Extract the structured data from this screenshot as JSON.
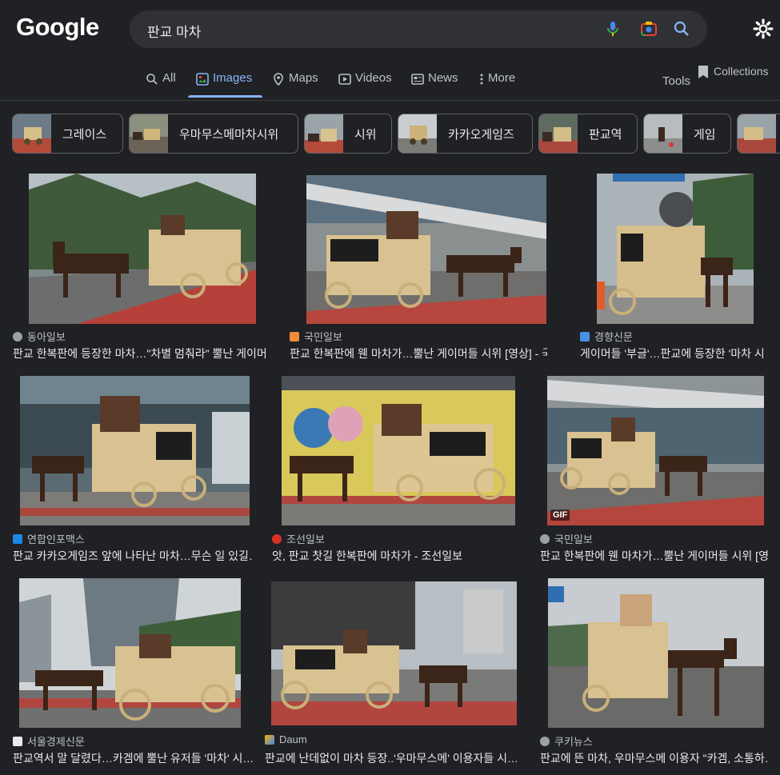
{
  "header": {
    "logo": "Google",
    "search_query": "판교 마차",
    "tabs": [
      "All",
      "Images",
      "Maps",
      "Videos",
      "News",
      "More"
    ],
    "active_tab": "Images",
    "tools_label": "Tools",
    "collections_label": "Collections"
  },
  "chips": [
    "그레이스",
    "우마무스메마차시위",
    "시위",
    "카카오게임즈",
    "판교역",
    "게임",
    ""
  ],
  "results": [
    {
      "source": "동아일보",
      "title": "판교 한복판에 등장한 마차…\"차별 멈춰라\" 뿔난 게이머…",
      "fav_color": "#9aa0a6"
    },
    {
      "source": "국민일보",
      "title": "판교 한복판에 웬 마차가…뿔난 게이머들 시위 [영상] - 국…",
      "fav_color": "#f28b36"
    },
    {
      "source": "경향신문",
      "title": "게이머들 '부글'…판교에 등장한 '마차 시…",
      "fav_color": "#4a90e2"
    },
    {
      "source": "연합인포맥스",
      "title": "판교 카카오게임즈 앞에 나타난 마차…무슨 일 있길…",
      "fav_color": "#1e88e5"
    },
    {
      "source": "조선일보",
      "title": "앗, 판교 찻길 한복판에 마차가 - 조선일보",
      "fav_color": "#d93025"
    },
    {
      "source": "국민일보",
      "title": "판교 한복판에 웬 마차가…뿔난 게이머들 시위 [영…",
      "fav_color": "#9aa0a6",
      "badge": "GIF"
    },
    {
      "source": "서울경제신문",
      "title": "판교역서 말 달렸다…카겜에 뿔난 유저들 '마차' 시…",
      "fav_color": "#e8eaed"
    },
    {
      "source": "Daum",
      "title": "판교에 난데없이 마차 등장..'우마무스메' 이용자들 시…",
      "fav_color": "#f4b400"
    },
    {
      "source": "쿠키뉴스",
      "title": "판교에 뜬 마차, 우마무스메 이용자 \"카겜, 소통하…",
      "fav_color": "#9aa0a6"
    }
  ],
  "colors": {
    "background": "#202124",
    "accent": "#8ab4f8",
    "text": "#e8eaed",
    "muted": "#bdc1c6"
  },
  "icons": [
    "mic-icon",
    "camera-icon",
    "search-icon",
    "gear-icon",
    "chevron-right-icon",
    "bookmark-icon"
  ]
}
